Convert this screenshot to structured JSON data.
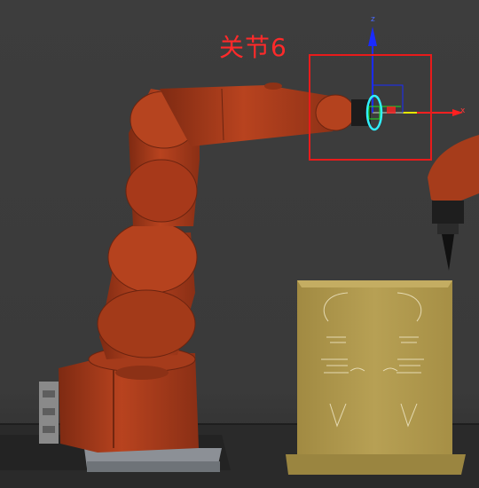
{
  "annotation": {
    "label": "关节6",
    "color": "#ff2a2a"
  },
  "gizmo": {
    "z_label": "z",
    "x_label": "x",
    "z_color": "#1a2bff",
    "x_color": "#ff2020",
    "y_color": "#20e020"
  },
  "colors": {
    "background": "#3a3a3a",
    "robot": "#b13d1c",
    "box": "#b09a4e",
    "selection": "#e81b1b"
  },
  "icons": [
    "transform-gizmo-icon",
    "joint-selection-ring-icon"
  ]
}
